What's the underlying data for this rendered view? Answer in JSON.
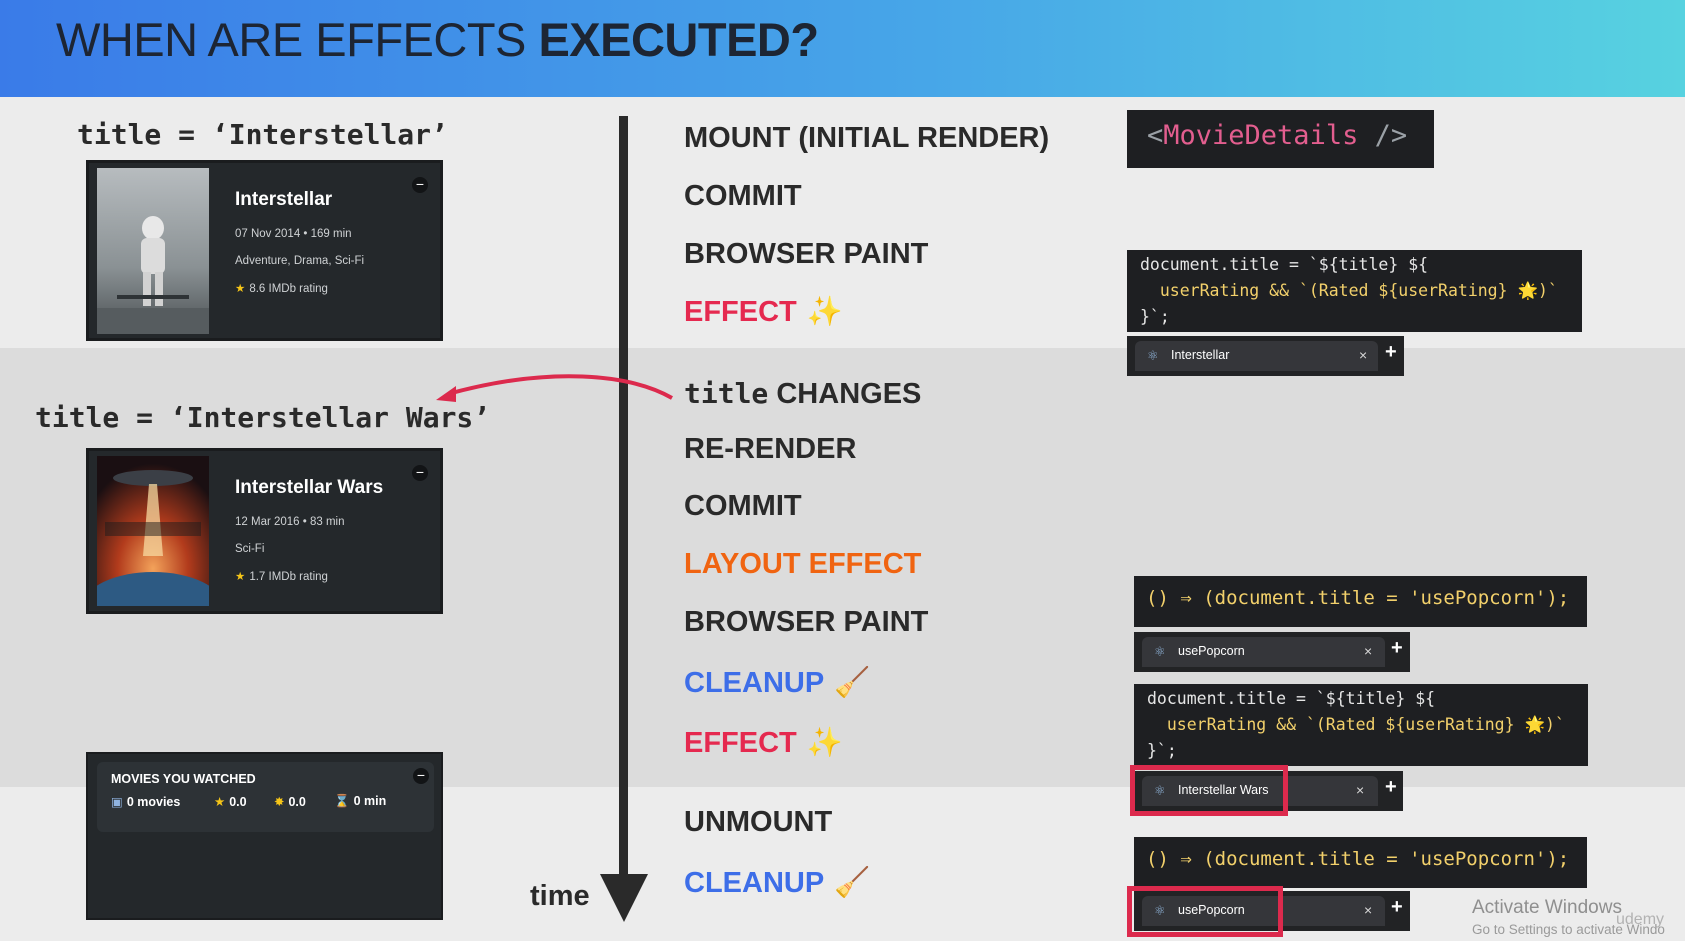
{
  "header": {
    "title_prefix": "WHEN ARE EFFECTS",
    "title_bold": "EXECUTED?"
  },
  "states": [
    {
      "label": "title = ‘Interstellar’"
    },
    {
      "label": "title = ‘Interstellar Wars’"
    }
  ],
  "movies": [
    {
      "title": "Interstellar",
      "meta": "07 Nov 2014 • 169 min",
      "genre": "Adventure, Drama, Sci-Fi",
      "rating": "8.6 IMDb rating"
    },
    {
      "title": "Interstellar Wars",
      "meta": "12 Mar 2016 • 83 min",
      "genre": "Sci-Fi",
      "rating": "1.7 IMDb rating"
    }
  ],
  "watched": {
    "heading": "MOVIES YOU WATCHED",
    "movies": "0 movies",
    "imdb": "0.0",
    "user": "0.0",
    "runtime": "0 min"
  },
  "timeline": {
    "time_label": "time",
    "steps": [
      {
        "text": "MOUNT (INITIAL RENDER)",
        "kind": "normal"
      },
      {
        "text": "COMMIT",
        "kind": "normal"
      },
      {
        "text": "BROWSER PAINT",
        "kind": "normal"
      },
      {
        "text": "EFFECT",
        "kind": "effect"
      },
      {
        "code": "title",
        "text": "CHANGES",
        "kind": "normal"
      },
      {
        "text": "RE-RENDER",
        "kind": "normal"
      },
      {
        "text": "COMMIT",
        "kind": "normal"
      },
      {
        "text": "LAYOUT EFFECT",
        "kind": "layout"
      },
      {
        "text": "BROWSER PAINT",
        "kind": "normal"
      },
      {
        "text": "CLEANUP",
        "kind": "cleanup"
      },
      {
        "text": "EFFECT",
        "kind": "effect"
      },
      {
        "text": "UNMOUNT",
        "kind": "normal"
      },
      {
        "text": "CLEANUP",
        "kind": "cleanup"
      }
    ]
  },
  "code": {
    "component": "MovieDetails",
    "tag_open": "<",
    "tag_close": " />",
    "effect_line1": "document.title = `${title} ${",
    "effect_line2": "  userRating && `(Rated ${userRating} 🌟)`",
    "effect_line3": "}`;",
    "cleanup": "() ⇒ (document.title = 'usePopcorn');"
  },
  "tabs": [
    "Interstellar",
    "usePopcorn",
    "Interstellar Wars",
    "usePopcorn"
  ],
  "tab_close": "×",
  "tab_plus": "+",
  "watermark": {
    "line1": "Activate Windows",
    "line2": "Go to Settings to activate Windo",
    "brand": "udemy"
  },
  "colors": {
    "effect": "#e5294f",
    "layout_effect": "#f06411",
    "cleanup": "#3d6ee8",
    "highlight": "#dc2a4d",
    "arrow": "#dc2a4d"
  }
}
